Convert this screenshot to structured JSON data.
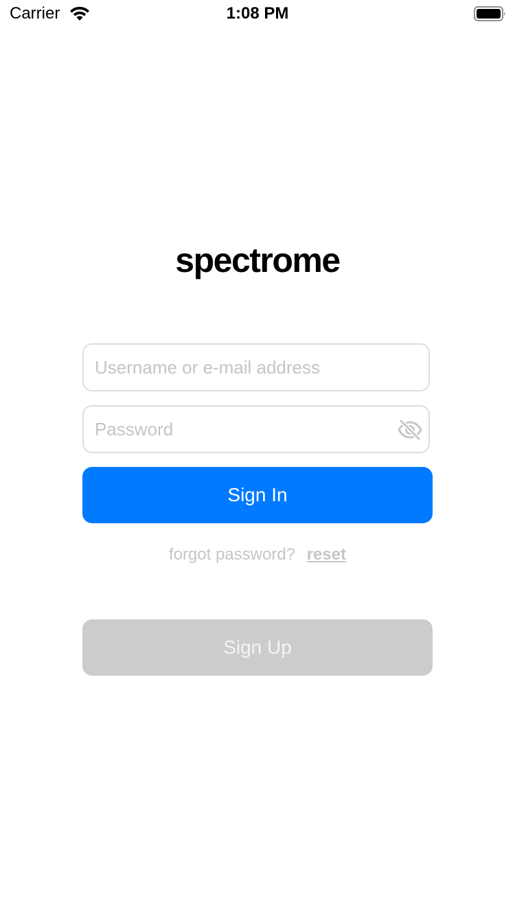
{
  "status_bar": {
    "carrier": "Carrier",
    "time": "1:08 PM",
    "wifi_icon": "wifi-icon",
    "battery_icon": "battery-full-icon"
  },
  "app": {
    "logo_text": "spectrome"
  },
  "form": {
    "username": {
      "value": "",
      "placeholder": "Username or e-mail address"
    },
    "password": {
      "value": "",
      "placeholder": "Password",
      "toggle_icon": "eye-slash-icon"
    },
    "sign_in_label": "Sign In",
    "forgot_text": "forgot password?",
    "reset_label": "reset",
    "sign_up_label": "Sign Up"
  },
  "colors": {
    "primary": "#007aff",
    "disabled_button": "#cccccc",
    "placeholder": "#c4c4c6",
    "field_border": "#dddddd"
  }
}
